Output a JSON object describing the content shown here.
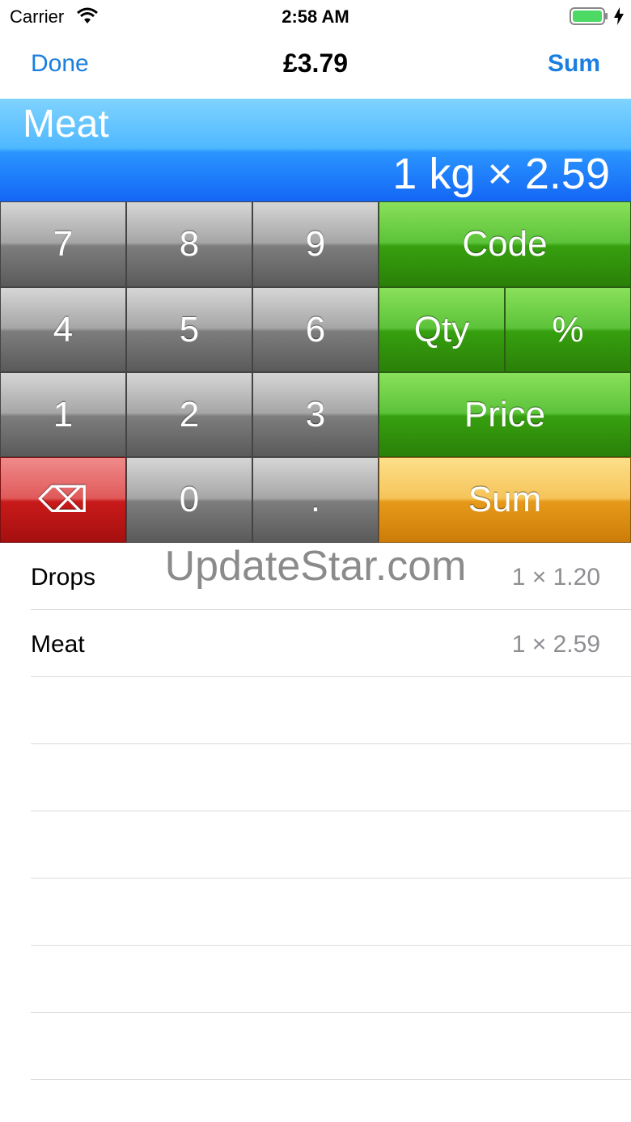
{
  "status_bar": {
    "carrier": "Carrier",
    "time": "2:58 AM"
  },
  "nav": {
    "done_label": "Done",
    "title": "£3.79",
    "sum_label": "Sum"
  },
  "display": {
    "item_name": "Meat",
    "expression": "1 kg × 2.59"
  },
  "keypad": {
    "k7": "7",
    "k8": "8",
    "k9": "9",
    "code": "Code",
    "k4": "4",
    "k5": "5",
    "k6": "6",
    "qty": "Qty",
    "percent": "%",
    "k1": "1",
    "k2": "2",
    "k3": "3",
    "price": "Price",
    "backspace": "⌫",
    "k0": "0",
    "dot": ".",
    "sum": "Sum"
  },
  "colors": {
    "accent": "#1a7fe0",
    "display_top": "#7fd3ff",
    "display_bottom": "#1466f5",
    "green": "#37a00f",
    "red": "#c91a1a",
    "orange": "#e69a1a"
  },
  "items": [
    {
      "name": "Drops",
      "qty": "1 × 1.20"
    },
    {
      "name": "Meat",
      "qty": "1 × 2.59"
    }
  ],
  "watermark": "UpdateStar.com"
}
